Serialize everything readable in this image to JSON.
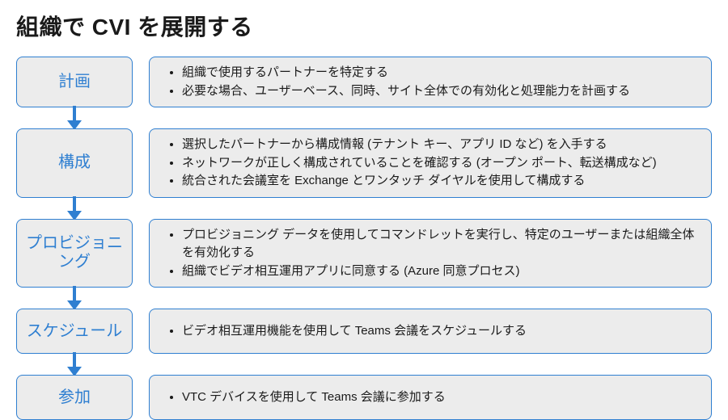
{
  "title": "組織で CVI を展開する",
  "stages": [
    {
      "label": "計画",
      "items": [
        "組織で使用するパートナーを特定する",
        "必要な場合、ユーザーベース、同時、サイト全体での有効化と処理能力を計画する"
      ]
    },
    {
      "label": "構成",
      "items": [
        "選択したパートナーから構成情報 (テナント キー、アプリ ID など) を入手する",
        "ネットワークが正しく構成されていることを確認する (オープン ポート、転送構成など)",
        "統合された会議室を Exchange とワンタッチ ダイヤルを使用して構成する"
      ]
    },
    {
      "label": "プロビジョニング",
      "items": [
        "プロビジョニング データを使用してコマンドレットを実行し、特定のユーザーまたは組織全体を有効化する",
        "組織でビデオ相互運用アプリに同意する (Azure 同意プロセス)"
      ]
    },
    {
      "label": "スケジュール",
      "items": [
        "ビデオ相互運用機能を使用して Teams 会議をスケジュールする"
      ]
    },
    {
      "label": "参加",
      "items": [
        "VTC デバイスを使用して Teams 会議に参加する"
      ]
    }
  ]
}
